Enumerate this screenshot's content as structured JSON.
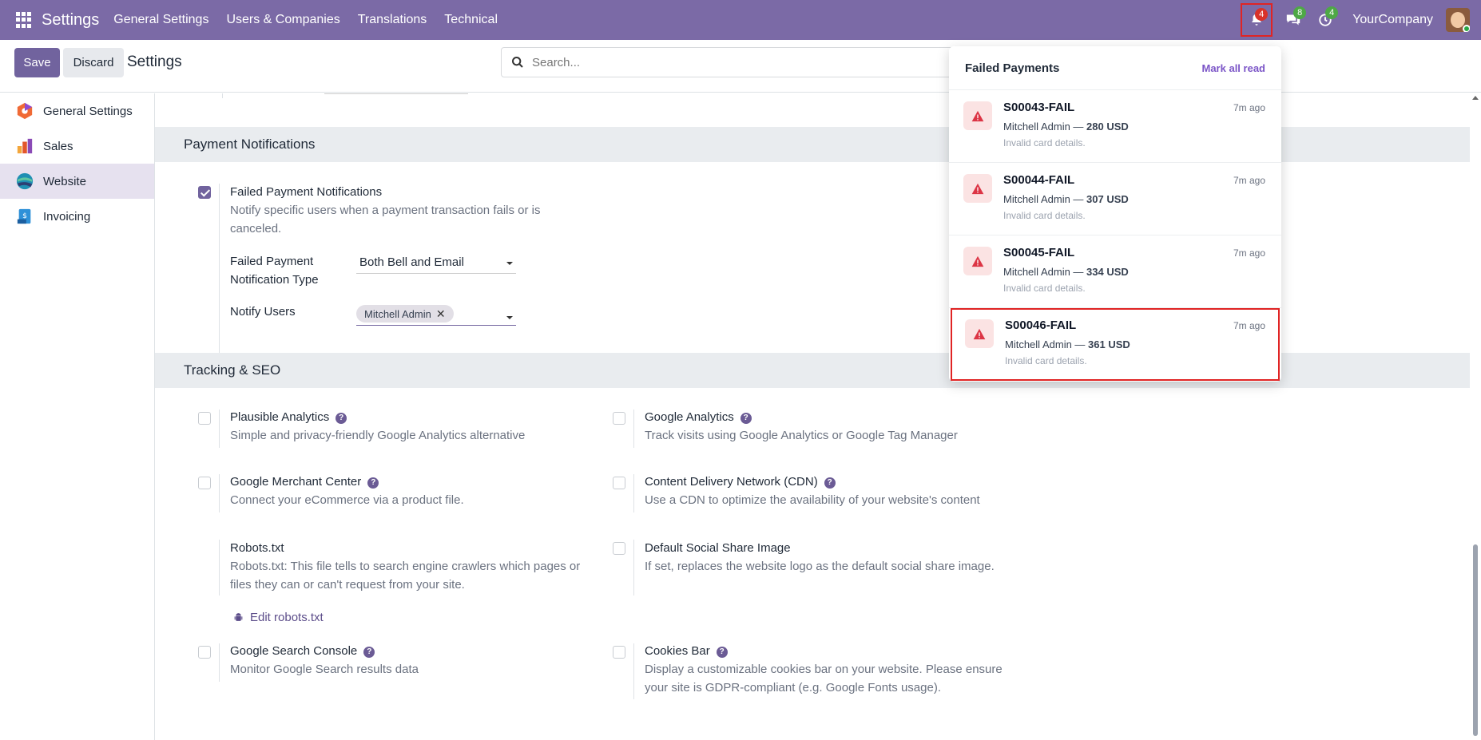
{
  "navbar": {
    "brand": "Settings",
    "menu": [
      "General Settings",
      "Users & Companies",
      "Translations",
      "Technical"
    ],
    "bell_count": "4",
    "messages_count": "8",
    "activities_count": "4",
    "company": "YourCompany"
  },
  "control": {
    "save_label": "Save",
    "discard_label": "Discard",
    "title": "Settings",
    "search_placeholder": "Search..."
  },
  "sidebar": {
    "items": [
      {
        "label": "General Settings",
        "icon": "general-settings-icon"
      },
      {
        "label": "Sales",
        "icon": "sales-icon"
      },
      {
        "label": "Website",
        "icon": "website-icon",
        "active": true
      },
      {
        "label": "Invoicing",
        "icon": "invoicing-icon"
      }
    ]
  },
  "payment_notifications": {
    "header": "Payment Notifications",
    "failed_title": "Failed Payment Notifications",
    "failed_desc": "Notify specific users when a payment transaction fails or is canceled.",
    "type_label": "Failed Payment Notification Type",
    "type_value": "Both Bell and Email",
    "notify_label": "Notify Users",
    "notify_tag": "Mitchell Admin"
  },
  "tracking": {
    "header": "Tracking & SEO",
    "items": [
      {
        "title": "Plausible Analytics",
        "desc": "Simple and privacy-friendly Google Analytics alternative"
      },
      {
        "title": "Google Analytics",
        "desc": "Track visits using Google Analytics or Google Tag Manager"
      },
      {
        "title": "Google Merchant Center",
        "desc": "Connect your eCommerce via a product file."
      },
      {
        "title": "Content Delivery Network (CDN)",
        "desc": "Use a CDN to optimize the availability of your website's content"
      },
      {
        "title": "Robots.txt",
        "desc": "Robots.txt: This file tells to search engine crawlers which pages or files they can or can't request from your site."
      },
      {
        "title": "Default Social Share Image",
        "desc": "If set, replaces the website logo as the default social share image."
      },
      {
        "title": "Google Search Console",
        "desc": "Monitor Google Search results data"
      },
      {
        "title": "Cookies Bar",
        "desc": "Display a customizable cookies bar on your website. Please ensure your site is GDPR-compliant (e.g. Google Fonts usage)."
      }
    ],
    "edit_robots": "Edit robots.txt"
  },
  "dropdown": {
    "title": "Failed Payments",
    "mark_all": "Mark all read",
    "items": [
      {
        "title": "S00043-FAIL",
        "time": "7m ago",
        "who": "Mitchell Admin —",
        "amount": "280 USD",
        "detail": "Invalid card details."
      },
      {
        "title": "S00044-FAIL",
        "time": "7m ago",
        "who": "Mitchell Admin —",
        "amount": "307 USD",
        "detail": "Invalid card details."
      },
      {
        "title": "S00045-FAIL",
        "time": "7m ago",
        "who": "Mitchell Admin —",
        "amount": "334 USD",
        "detail": "Invalid card details."
      },
      {
        "title": "S00046-FAIL",
        "time": "7m ago",
        "who": "Mitchell Admin —",
        "amount": "361 USD",
        "detail": "Invalid card details."
      }
    ]
  },
  "colors": {
    "navbar": "#7b6aa6",
    "primary": "#71639e",
    "alert": "#e02424"
  }
}
